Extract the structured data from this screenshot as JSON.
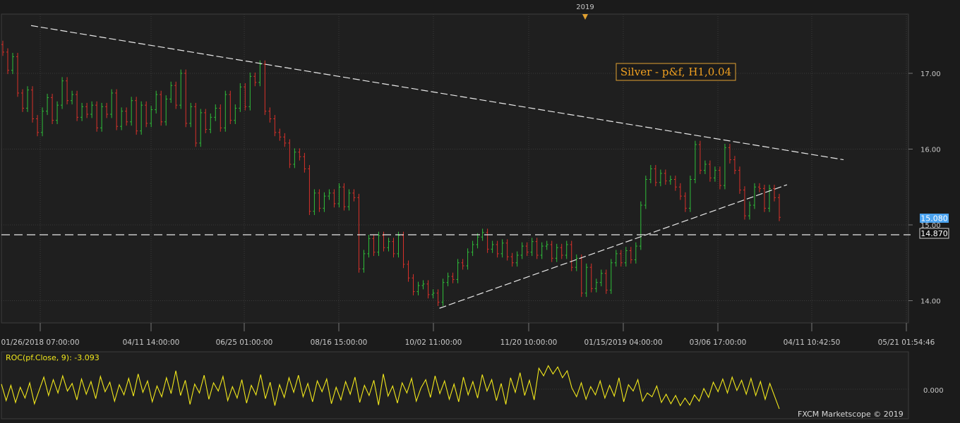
{
  "app": {
    "year_marker": "2019",
    "watermark": "FXCM Marketscope © 2019"
  },
  "colors": {
    "background": "#1b1b1b",
    "panel": "#1f1f1f",
    "grid": "#3a3a3a",
    "bull": "#2fbf3a",
    "bear": "#d9312a",
    "trendline": "#e8e8e8",
    "label_text": "#f0a020",
    "label_border": "#e0a030",
    "last_price_bg": "#4aa3f0",
    "indicator": "#f2e81b",
    "axis_text": "#c8c8c8"
  },
  "chart_data": [
    {
      "type": "line",
      "kind": "point-and-figure bars",
      "title": "Silver - p&f, H1,0.04",
      "y_ticks": [
        "14.00",
        "15.00",
        "16.00",
        "17.00"
      ],
      "ylim": [
        13.9,
        17.5
      ],
      "x_ticks": [
        "01/26/2018 07:00:00",
        "04/11 14:00:00",
        "06/25 01:00:00",
        "08/16 15:00:00",
        "10/02 11:00:00",
        "11/20 10:00:00",
        "01/15/2019 04:00:00",
        "03/06 17:00:00",
        "04/11 10:42:50",
        "05/21 01:54:46"
      ],
      "bar_count": 154,
      "close": [
        17.28,
        17.04,
        17.22,
        16.74,
        16.54,
        16.78,
        16.4,
        16.22,
        16.5,
        16.68,
        16.38,
        16.58,
        16.9,
        16.64,
        16.72,
        16.42,
        16.56,
        16.46,
        16.58,
        16.28,
        16.56,
        16.46,
        16.74,
        16.3,
        16.5,
        16.36,
        16.64,
        16.24,
        16.58,
        16.34,
        16.52,
        16.72,
        16.36,
        16.66,
        16.84,
        16.58,
        17.0,
        16.34,
        16.56,
        16.08,
        16.48,
        16.26,
        16.42,
        16.54,
        16.28,
        16.72,
        16.38,
        16.54,
        16.82,
        16.56,
        16.96,
        16.88,
        17.12,
        16.5,
        16.4,
        16.22,
        16.16,
        16.08,
        15.8,
        15.96,
        15.9,
        15.74,
        15.18,
        15.42,
        15.22,
        15.38,
        15.42,
        15.28,
        15.5,
        15.24,
        15.42,
        15.36,
        14.42,
        14.62,
        14.82,
        14.64,
        14.86,
        14.7,
        14.78,
        14.62,
        14.86,
        14.48,
        14.3,
        14.12,
        14.2,
        14.22,
        14.08,
        14.1,
        13.98,
        14.24,
        14.32,
        14.28,
        14.5,
        14.46,
        14.64,
        14.74,
        14.84,
        14.9,
        14.68,
        14.74,
        14.62,
        14.76,
        14.58,
        14.5,
        14.6,
        14.72,
        14.64,
        14.78,
        14.6,
        14.72,
        14.74,
        14.56,
        14.7,
        14.6,
        14.74,
        14.44,
        14.56,
        14.1,
        14.44,
        14.16,
        14.24,
        14.36,
        14.14,
        14.5,
        14.62,
        14.5,
        14.66,
        14.54,
        14.72,
        15.26,
        15.6,
        15.74,
        15.56,
        15.68,
        15.58,
        15.6,
        15.5,
        15.38,
        15.22,
        15.6,
        16.06,
        15.72,
        15.8,
        15.62,
        15.72,
        15.52,
        16.02,
        15.86,
        15.72,
        15.46,
        15.12,
        15.26,
        15.5,
        15.48,
        15.22,
        15.48,
        15.36,
        15.1
      ]
    },
    {
      "type": "line",
      "title": "ROC(pf.Close, 9): -3.093",
      "y_ticks": [
        "0.000"
      ],
      "samples": [
        0.8,
        -1.8,
        0.6,
        -2.1,
        0.3,
        -1.4,
        1.0,
        -2.3,
        -0.2,
        1.9,
        -1.0,
        1.5,
        -0.6,
        2.1,
        -0.3,
        0.9,
        -1.7,
        1.6,
        -0.8,
        1.2,
        -1.5,
        2.0,
        -0.4,
        1.1,
        -1.9,
        0.7,
        -0.9,
        1.7,
        -1.1,
        2.4,
        -0.5,
        1.3,
        -2.0,
        0.5,
        -1.2,
        1.8,
        -0.7,
        2.9,
        -1.0,
        1.4,
        -2.4,
        0.8,
        -0.6,
        2.2,
        -1.6,
        1.0,
        -0.3,
        2.0,
        -1.8,
        0.4,
        -1.4,
        1.5,
        -2.2,
        0.6,
        -0.9,
        2.3,
        -1.5,
        1.1,
        -2.6,
        0.7,
        -1.3,
        1.8,
        -0.5,
        2.2,
        -1.2,
        0.9,
        -2.0,
        1.3,
        -0.4,
        1.6,
        -2.3,
        0.3,
        -1.7,
        1.2,
        -0.8,
        1.9,
        -2.1,
        0.6,
        -1.0,
        1.4,
        -2.5,
        2.4,
        -1.1,
        0.5,
        -2.2,
        1.0,
        -0.6,
        1.7,
        -1.9,
        0.2,
        1.5,
        -1.3,
        2.1,
        -0.7,
        1.3,
        -1.6,
        0.8,
        -2.0,
        1.9,
        -0.9,
        1.2,
        -1.4,
        2.3,
        -0.3,
        1.5,
        -1.8,
        0.9,
        -2.4,
        1.8,
        -0.5,
        2.6,
        -1.0,
        1.4,
        -1.7,
        3.3,
        2.1,
        3.7,
        2.4,
        3.5,
        1.8,
        2.9,
        0.2,
        -1.2,
        1.0,
        -1.6,
        0.4,
        -0.9,
        1.3,
        -1.4,
        0.6,
        -1.1,
        1.8,
        -2.0,
        0.7,
        -0.3,
        1.5,
        -1.9,
        -0.6,
        -1.2,
        0.5,
        -2.1,
        -0.8,
        -2.3,
        -1.0,
        -2.6,
        -1.4,
        -2.5,
        -0.9,
        -1.9,
        0.1,
        -1.3,
        1.1,
        -0.4,
        1.6,
        -0.6,
        1.9,
        -0.2,
        1.4,
        -0.8,
        1.7,
        -1.0,
        1.2,
        -1.6,
        0.9,
        -1.1,
        -3.1
      ]
    }
  ],
  "overlays": {
    "label_box": "Silver - p&f, H1,0.04",
    "last_price": "15.080",
    "hline_price": "14.870",
    "hline_value": 14.87,
    "upper_trend": {
      "from": [
        0,
        17.63
      ],
      "to": [
        170,
        15.86
      ]
    },
    "lower_trend": {
      "from": [
        88,
        13.9
      ],
      "to": [
        150,
        15.53
      ]
    }
  }
}
